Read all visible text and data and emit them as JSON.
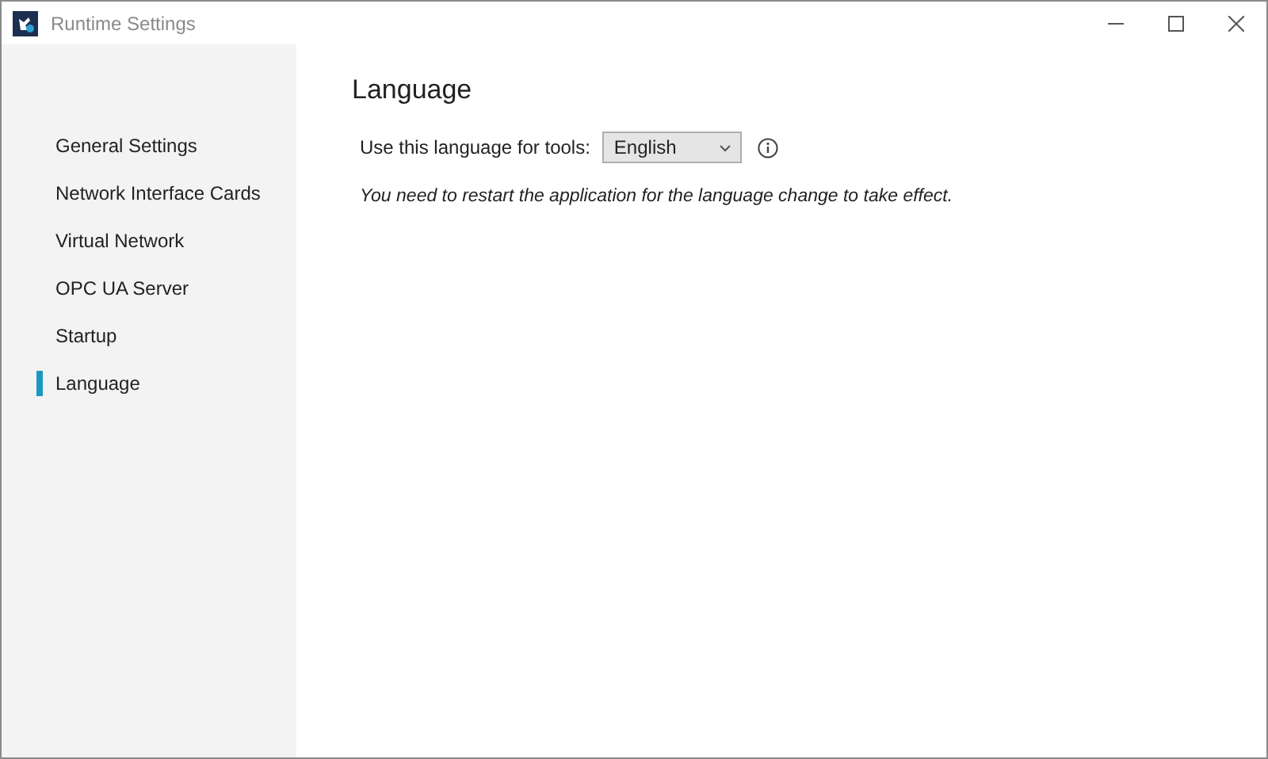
{
  "window": {
    "title": "Runtime Settings"
  },
  "sidebar": {
    "items": [
      {
        "label": "General Settings",
        "selected": false
      },
      {
        "label": "Network Interface Cards",
        "selected": false
      },
      {
        "label": "Virtual Network",
        "selected": false
      },
      {
        "label": "OPC UA Server",
        "selected": false
      },
      {
        "label": "Startup",
        "selected": false
      },
      {
        "label": "Language",
        "selected": true
      }
    ]
  },
  "content": {
    "heading": "Language",
    "field_label": "Use this language for tools:",
    "language": {
      "value": "English"
    },
    "note": "You need to restart the application for the language change to take effect."
  }
}
